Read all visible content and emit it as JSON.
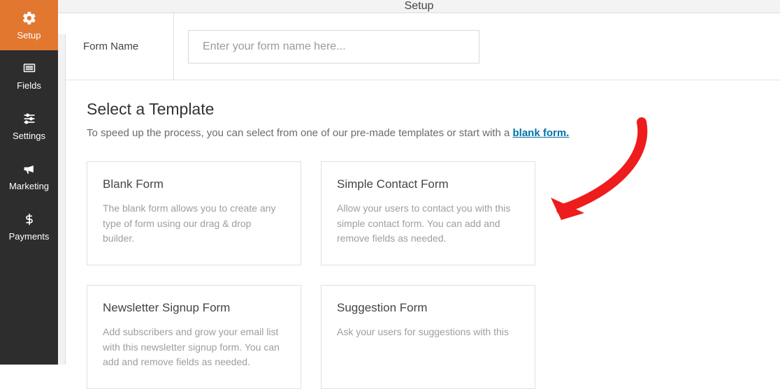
{
  "sidebar": {
    "items": [
      {
        "label": "Setup"
      },
      {
        "label": "Fields"
      },
      {
        "label": "Settings"
      },
      {
        "label": "Marketing"
      },
      {
        "label": "Payments"
      }
    ]
  },
  "header": {
    "title": "Setup"
  },
  "form_name": {
    "label": "Form Name",
    "placeholder": "Enter your form name here..."
  },
  "template_section": {
    "title": "Select a Template",
    "desc_prefix": "To speed up the process, you can select from one of our pre-made templates or start with a ",
    "desc_link": "blank form."
  },
  "templates": [
    {
      "title": "Blank Form",
      "desc": "The blank form allows you to create any type of form using our drag & drop builder."
    },
    {
      "title": "Simple Contact Form",
      "desc": "Allow your users to contact you with this simple contact form. You can add and remove fields as needed."
    },
    {
      "title": "Newsletter Signup Form",
      "desc": "Add subscribers and grow your email list with this newsletter signup form. You can add and remove fields as needed."
    },
    {
      "title": "Suggestion Form",
      "desc": "Ask your users for suggestions with this"
    }
  ]
}
